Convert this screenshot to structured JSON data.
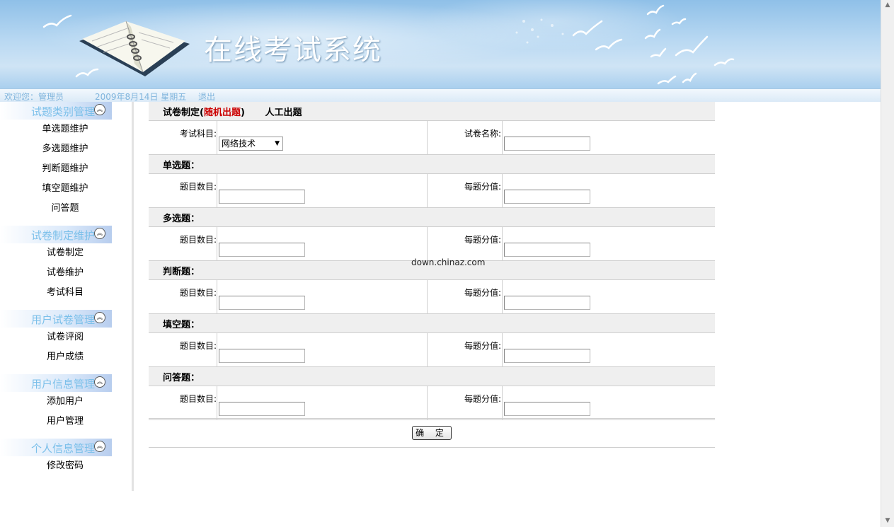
{
  "banner": {
    "title": "在线考试系统"
  },
  "status": {
    "welcome": "欢迎您：管理员",
    "date": "2009年8月14日 星期五",
    "logout": "退出"
  },
  "sidebar": {
    "groups": [
      {
        "title": "试题类别管理",
        "items": [
          "单选题维护",
          "多选题维护",
          "判断题维护",
          "填空题维护",
          "问答题"
        ]
      },
      {
        "title": "试卷制定维护",
        "items": [
          "试卷制定",
          "试卷维护",
          "考试科目"
        ]
      },
      {
        "title": "用户试卷管理",
        "items": [
          "试卷评阅",
          "用户成绩"
        ]
      },
      {
        "title": "用户信息管理",
        "items": [
          "添加用户",
          "用户管理"
        ]
      },
      {
        "title": "个人信息管理",
        "items": [
          "修改密码"
        ]
      }
    ],
    "toggle_icon": "collapse-up-icon"
  },
  "form": {
    "header": {
      "prefix": "试卷制定(",
      "random": "随机出题",
      "suffix": ")",
      "manual": "人工出题"
    },
    "subject_label": "考试科目:",
    "subject_value": "网络技术",
    "paper_name_label": "试卷名称:",
    "paper_name_value": "",
    "sections": [
      {
        "title": "单选题：",
        "count_label": "题目数目:",
        "score_label": "每题分值:"
      },
      {
        "title": "多选题：",
        "count_label": "题目数目:",
        "score_label": "每题分值:"
      },
      {
        "title": "判断题：",
        "count_label": "题目数目:",
        "score_label": "每题分值:"
      },
      {
        "title": "填空题：",
        "count_label": "题目数目:",
        "score_label": "每题分值:"
      },
      {
        "title": "问答题：",
        "count_label": "题目数目:",
        "score_label": "每题分值:"
      }
    ],
    "submit_label": "确 定"
  },
  "watermark": "down.chinaz.com",
  "colors": {
    "accent_red": "#cc0000",
    "sidebar_title": "#7cc0ea",
    "status_text": "#7fb4dc"
  }
}
